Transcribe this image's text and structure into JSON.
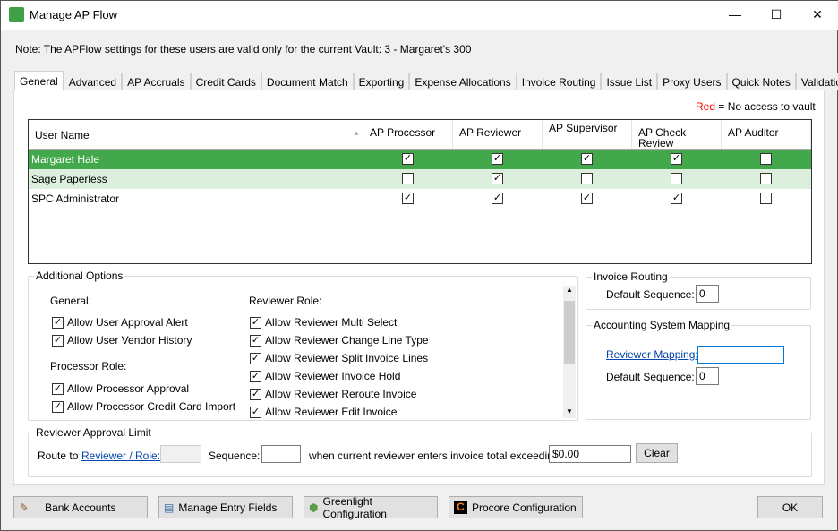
{
  "window": {
    "title": "Manage AP Flow",
    "minimize": "—",
    "maximize": "☐",
    "close": "✕"
  },
  "note": "Note:  The APFlow settings for these users are valid only for the current Vault: 3 - Margaret's 300",
  "tabs": [
    "General",
    "Advanced",
    "AP Accruals",
    "Credit Cards",
    "Document Match",
    "Exporting",
    "Expense Allocations",
    "Invoice Routing",
    "Issue List",
    "Proxy Users",
    "Quick Notes",
    "Validation"
  ],
  "legend": {
    "red": "Red",
    "text": "= No access to vault",
    "color": "#ff0000"
  },
  "grid": {
    "columns": [
      "User Name",
      "AP Processor",
      "AP Reviewer",
      "AP Supervisor",
      "AP Check Review",
      "AP Auditor"
    ],
    "rows": [
      {
        "name": "Margaret Hale",
        "checks": [
          true,
          true,
          true,
          true,
          false
        ],
        "selected": true
      },
      {
        "name": "Sage Paperless",
        "checks": [
          false,
          true,
          false,
          false,
          false
        ]
      },
      {
        "name": "SPC Administrator",
        "checks": [
          true,
          true,
          true,
          true,
          false
        ]
      }
    ],
    "selected_color": "#43a84b",
    "alt_color": "#dcefdc"
  },
  "additional": {
    "title": "Additional Options",
    "general_label": "General:",
    "general": [
      "Allow User Approval Alert",
      "Allow User Vendor History"
    ],
    "processor_label": "Processor Role:",
    "processor": [
      "Allow Processor Approval",
      "Allow Processor Credit Card Import"
    ],
    "reviewer_label": "Reviewer Role:",
    "reviewer": [
      "Allow Reviewer Multi Select",
      "Allow Reviewer Change Line Type",
      "Allow Reviewer Split Invoice Lines",
      "Allow Reviewer Invoice Hold",
      "Allow Reviewer Reroute Invoice",
      "Allow Reviewer Edit Invoice"
    ]
  },
  "invoice_routing": {
    "title": "Invoice Routing",
    "label": "Default Sequence:",
    "value": "0"
  },
  "mapping": {
    "title": "Accounting System Mapping",
    "link": "Reviewer Mapping:",
    "value": "",
    "seq_label": "Default Sequence:",
    "seq_value": "0"
  },
  "limit": {
    "title": "Reviewer Approval Limit",
    "route_to": "Route to",
    "link": "Reviewer / Role:",
    "role_value": "",
    "seq_label": "Sequence:",
    "seq_value": "",
    "when": "when current reviewer enters invoice total exceeding:",
    "amount": "$0.00",
    "clear": "Clear"
  },
  "buttons": {
    "bank": "Bank Accounts",
    "entry": "Manage Entry Fields",
    "greenlight": "Greenlight Configuration",
    "procore": "Procore Configuration",
    "ok": "OK"
  }
}
